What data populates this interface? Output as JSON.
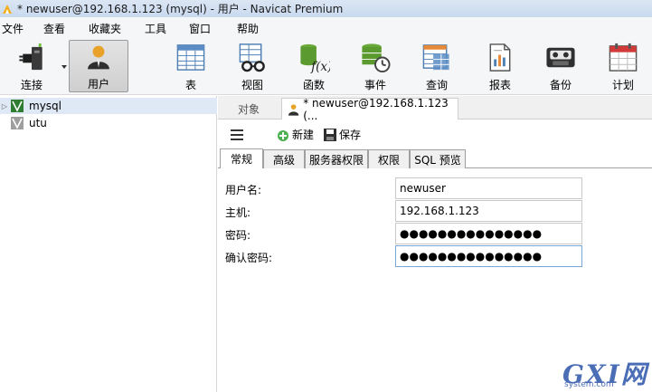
{
  "window": {
    "title": "* newuser@192.168.1.123 (mysql) - 用户 - Navicat Premium"
  },
  "menu": [
    "文件",
    "查看",
    "收藏夹",
    "工具",
    "窗口",
    "帮助"
  ],
  "toolbar": {
    "items": [
      {
        "label": "连接",
        "icon": "plug-icon"
      },
      {
        "label": "用户",
        "icon": "user-icon",
        "active": true
      },
      {
        "label": "表",
        "icon": "table-icon"
      },
      {
        "label": "视图",
        "icon": "view-icon"
      },
      {
        "label": "函数",
        "icon": "function-icon"
      },
      {
        "label": "事件",
        "icon": "event-icon"
      },
      {
        "label": "查询",
        "icon": "query-icon"
      },
      {
        "label": "报表",
        "icon": "report-icon"
      },
      {
        "label": "备份",
        "icon": "backup-icon"
      },
      {
        "label": "计划",
        "icon": "schedule-icon"
      }
    ]
  },
  "navigator": {
    "connections": [
      {
        "label": "mysql",
        "selected": true,
        "connected": true
      },
      {
        "label": "utu",
        "selected": false,
        "connected": false
      }
    ]
  },
  "doc_tabs": {
    "objects": "对象",
    "user_tab": "* newuser@192.168.1.123 (..."
  },
  "obj_toolbar": {
    "new_label": "新建",
    "save_label": "保存"
  },
  "sub_tabs": [
    "常规",
    "高级",
    "服务器权限",
    "权限",
    "SQL 预览"
  ],
  "form": {
    "username_label": "用户名:",
    "username_value": "newuser",
    "host_label": "主机:",
    "host_value": "192.168.1.123",
    "password_label": "密码:",
    "password_value": "●●●●●●●●●●●●●●●",
    "confirm_label": "确认密码:",
    "confirm_value": "●●●●●●●●●●●●●●●"
  },
  "watermark": {
    "logo": "GXI网",
    "site": "system.com"
  },
  "colors": {
    "titlebar": "#c9d9ee",
    "selection": "#dfe9f6",
    "watermark": "#4a6db5"
  }
}
